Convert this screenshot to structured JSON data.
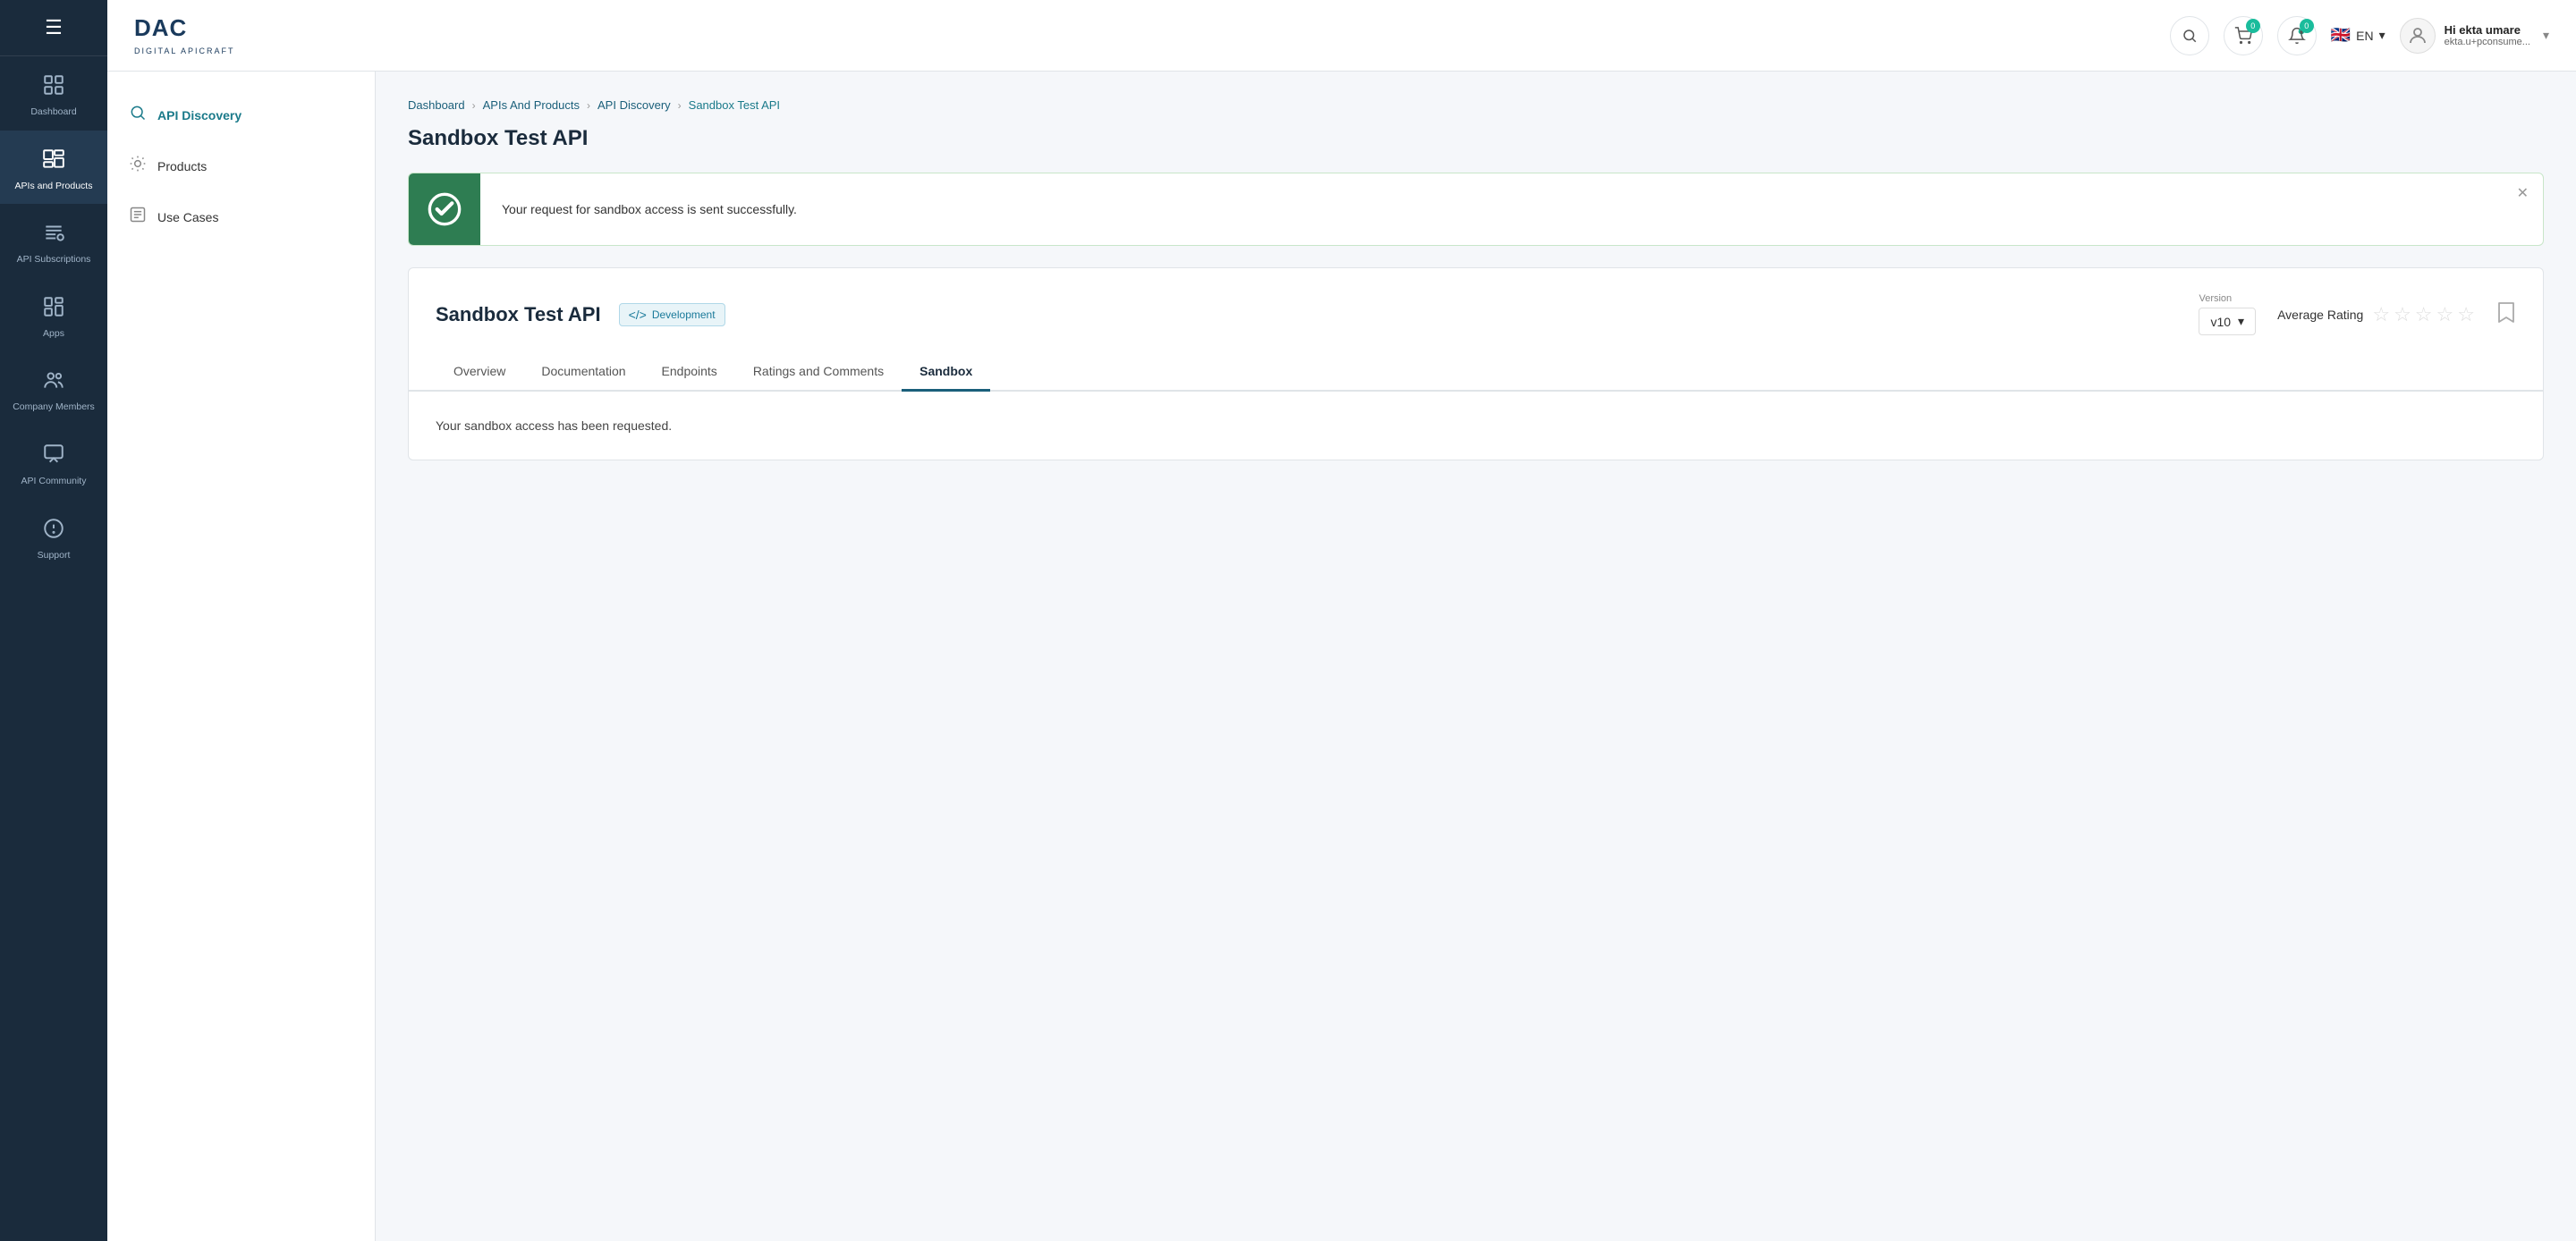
{
  "sidebar": {
    "menu_icon": "☰",
    "items": [
      {
        "id": "dashboard",
        "label": "Dashboard",
        "icon": "⊞",
        "active": false
      },
      {
        "id": "apis-products",
        "label": "APIs and Products",
        "icon": "▦",
        "active": true
      },
      {
        "id": "api-subscriptions",
        "label": "API Subscriptions",
        "icon": "≋",
        "active": false
      },
      {
        "id": "apps",
        "label": "Apps",
        "icon": "⊡",
        "active": false
      },
      {
        "id": "company-members",
        "label": "Company Members",
        "icon": "👥",
        "active": false
      },
      {
        "id": "api-community",
        "label": "API Community",
        "icon": "💬",
        "active": false
      },
      {
        "id": "support",
        "label": "Support",
        "icon": "🛈",
        "active": false
      }
    ]
  },
  "header": {
    "logo_main": "DAC",
    "logo_sub": "DIGITAL APICRAFT",
    "search_placeholder": "Search",
    "cart_badge": "0",
    "notif_badge": "0",
    "language": "EN",
    "user_name": "Hi ekta umare",
    "user_email": "ekta.u+pconsume..."
  },
  "left_panel": {
    "items": [
      {
        "id": "api-discovery",
        "label": "API Discovery",
        "icon": "🔍",
        "active": true
      },
      {
        "id": "products",
        "label": "Products",
        "icon": "⚙",
        "active": false
      },
      {
        "id": "use-cases",
        "label": "Use Cases",
        "icon": "📋",
        "active": false
      }
    ]
  },
  "breadcrumb": {
    "items": [
      {
        "label": "Dashboard",
        "link": true
      },
      {
        "label": "APIs And Products",
        "link": true
      },
      {
        "label": "API Discovery",
        "link": true
      },
      {
        "label": "Sandbox Test API",
        "link": false,
        "current": true
      }
    ]
  },
  "page_title": "Sandbox Test API",
  "success_banner": {
    "message": "Your request for sandbox access is sent successfully."
  },
  "api_detail": {
    "title": "Sandbox Test API",
    "badge_icon": "</>",
    "badge_label": "Development",
    "version_label": "Version",
    "version_value": "v10",
    "rating_label": "Average Rating",
    "stars": [
      "☆",
      "☆",
      "☆",
      "☆",
      "☆"
    ],
    "tabs": [
      {
        "id": "overview",
        "label": "Overview",
        "active": false
      },
      {
        "id": "documentation",
        "label": "Documentation",
        "active": false
      },
      {
        "id": "endpoints",
        "label": "Endpoints",
        "active": false
      },
      {
        "id": "ratings-comments",
        "label": "Ratings and Comments",
        "active": false
      },
      {
        "id": "sandbox",
        "label": "Sandbox",
        "active": true
      }
    ],
    "sandbox_message": "Your sandbox access has been requested."
  }
}
